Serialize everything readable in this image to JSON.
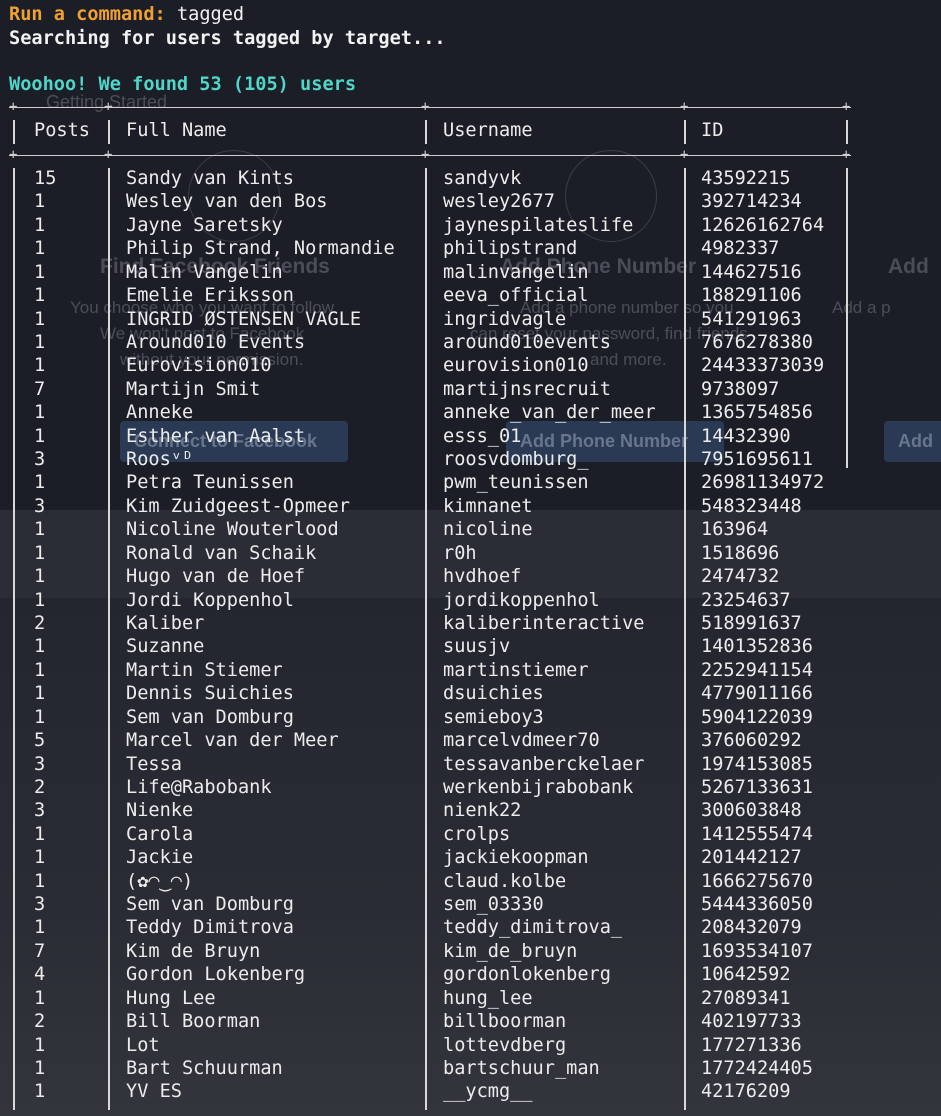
{
  "prompt": {
    "label": "Run a command:",
    "command": "tagged"
  },
  "status_line": "Searching for users tagged by target...",
  "result_line": "Woohoo! We found 53 (105) users",
  "table": {
    "headers": [
      "Posts",
      "Full Name",
      "Username",
      "ID"
    ],
    "rows": [
      [
        "15",
        "Sandy van Kints",
        "sandyvk",
        "43592215"
      ],
      [
        "1",
        "Wesley van den Bos",
        "wesley2677",
        "392714234"
      ],
      [
        "1",
        "Jayne Saretsky",
        "jaynespilateslife",
        "12626162764"
      ],
      [
        "1",
        "Philip Strand, Normandie",
        "philipstrand",
        "4982337"
      ],
      [
        "1",
        "Malin Vangelin",
        "malinvangelin",
        "144627516"
      ],
      [
        "1",
        "Emelie Eriksson",
        "eeva_official",
        "188291106"
      ],
      [
        "1",
        "INGRID ØSTENSEN VAGLE",
        "ingridvagle",
        "541291963"
      ],
      [
        "1",
        "Around010 Events",
        "around010events",
        "7676278380"
      ],
      [
        "1",
        "Eurovision010",
        "eurovision010",
        "24433373039"
      ],
      [
        "7",
        "Martijn Smit",
        "martijnsrecruit",
        "9738097"
      ],
      [
        "1",
        "Anneke",
        "anneke_van_der_meer",
        "1365754856"
      ],
      [
        "1",
        "Esther van Aalst",
        "esss_01",
        "14432390"
      ],
      [
        "3",
        "Roosᵛᴰ",
        "roosvdomburg_",
        "7951695611"
      ],
      [
        "1",
        "Petra Teunissen",
        "pwm_teunissen",
        "26981134972"
      ],
      [
        "3",
        "Kim Zuidgeest-Opmeer",
        "kimnanet",
        "548323448"
      ],
      [
        "1",
        "Nicoline Wouterlood",
        "nicoline",
        "163964"
      ],
      [
        "1",
        "Ronald van Schaik",
        "r0h",
        "1518696"
      ],
      [
        "1",
        "Hugo van de Hoef",
        "hvdhoef",
        "2474732"
      ],
      [
        "1",
        "Jordi Koppenhol",
        "jordikoppenhol",
        "23254637"
      ],
      [
        "2",
        "Kaliber",
        "kaliberinteractive",
        "518991637"
      ],
      [
        "1",
        "Suzanne",
        "suusjv",
        "1401352836"
      ],
      [
        "1",
        "Martin Stiemer",
        "martinstiemer",
        "2252941154"
      ],
      [
        "1",
        "Dennis Suichies",
        "dsuichies",
        "4779011166"
      ],
      [
        "1",
        "Sem van Domburg",
        "semieboy3",
        "5904122039"
      ],
      [
        "5",
        "Marcel van der Meer",
        "marcelvdmeer70",
        "376060292"
      ],
      [
        "3",
        "Tessa",
        "tessavanberckelaer",
        "1974153085"
      ],
      [
        "2",
        "Life@Rabobank",
        "werkenbijrabobank",
        "5267133631"
      ],
      [
        "3",
        "Nienke",
        "nienk22",
        "300603848"
      ],
      [
        "1",
        "Carola",
        "crolps",
        "1412555474"
      ],
      [
        "1",
        "Jackie",
        "jackiekoopman",
        "201442127"
      ],
      [
        "1",
        "(✿◠‿◠)",
        "claud.kolbe",
        "1666275670"
      ],
      [
        "3",
        "Sem van Domburg",
        "sem_03330",
        "5444336050"
      ],
      [
        "1",
        "Teddy Dimitrova",
        "teddy_dimitrova_",
        "208432079"
      ],
      [
        "7",
        "Kim de Bruyn",
        "kim_de_bruyn",
        "1693534107"
      ],
      [
        "4",
        "Gordon Lokenberg",
        "gordonlokenberg",
        "10642592"
      ],
      [
        "1",
        "Hung Lee",
        "hung_lee",
        "27089341"
      ],
      [
        "2",
        "Bill Boorman",
        "billboorman",
        "402197733"
      ],
      [
        "1",
        "Lot",
        "lottevdberg",
        "177271336"
      ],
      [
        "1",
        "Bart Schuurman",
        "bartschuur_man",
        "1772424405"
      ],
      [
        "1",
        "YV ES",
        "__ycmg__",
        "42176209"
      ]
    ]
  },
  "background": {
    "getting_started": "Getting Started",
    "find_friends": "Find Facebook Friends",
    "find_friends_desc": [
      "You choose who you want to follow.",
      "We won't post to Facebook",
      "without your permission."
    ],
    "add_phone": "Add Phone Number",
    "add_phone_desc": [
      "Add a phone number so you",
      "can reset your password, find friends",
      "and more."
    ],
    "add_profile": "Add",
    "add_profile_desc": "Add a p",
    "connect_button": "Connect to Facebook",
    "add_phone_button": "Add Phone Number",
    "add_button": "Add"
  },
  "colors": {
    "background": "#1c1e27",
    "prompt": "#f0a030",
    "result": "#4fd6c8",
    "text": "#ececec"
  }
}
